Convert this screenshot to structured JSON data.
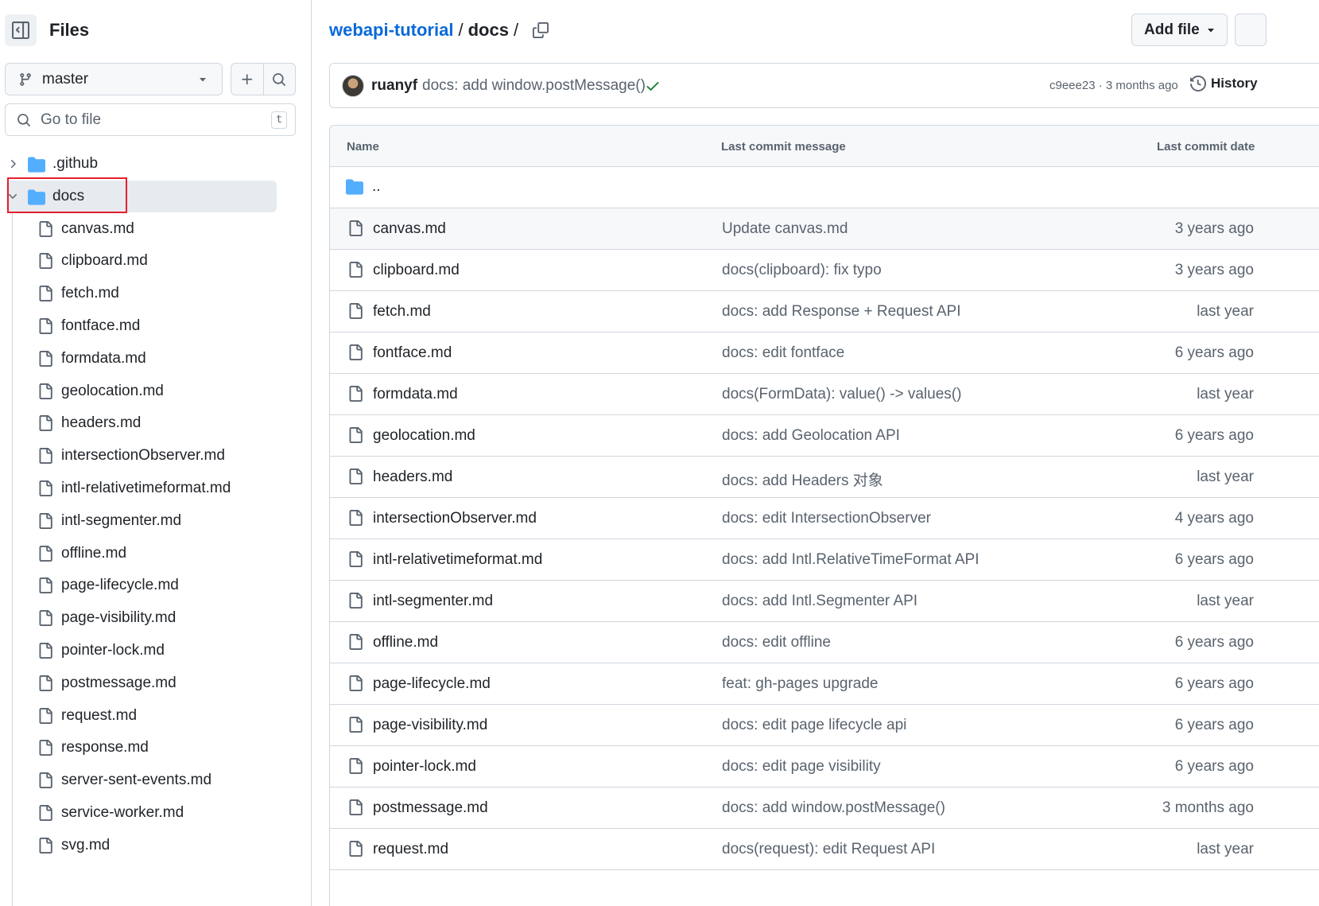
{
  "sidebar": {
    "title": "Files",
    "toggle_icon": "sidebar-collapse-icon",
    "branch": "master",
    "search_placeholder": "Go to file",
    "search_shortcut": "t",
    "tree": [
      {
        "type": "dir",
        "name": ".github",
        "expanded": false
      },
      {
        "type": "dir",
        "name": "docs",
        "expanded": true,
        "selected": true
      },
      {
        "type": "file",
        "name": "canvas.md"
      },
      {
        "type": "file",
        "name": "clipboard.md"
      },
      {
        "type": "file",
        "name": "fetch.md"
      },
      {
        "type": "file",
        "name": "fontface.md"
      },
      {
        "type": "file",
        "name": "formdata.md"
      },
      {
        "type": "file",
        "name": "geolocation.md"
      },
      {
        "type": "file",
        "name": "headers.md"
      },
      {
        "type": "file",
        "name": "intersectionObserver.md"
      },
      {
        "type": "file",
        "name": "intl-relativetimeformat.md"
      },
      {
        "type": "file",
        "name": "intl-segmenter.md"
      },
      {
        "type": "file",
        "name": "offline.md"
      },
      {
        "type": "file",
        "name": "page-lifecycle.md"
      },
      {
        "type": "file",
        "name": "page-visibility.md"
      },
      {
        "type": "file",
        "name": "pointer-lock.md"
      },
      {
        "type": "file",
        "name": "postmessage.md"
      },
      {
        "type": "file",
        "name": "request.md"
      },
      {
        "type": "file",
        "name": "response.md"
      },
      {
        "type": "file",
        "name": "server-sent-events.md"
      },
      {
        "type": "file",
        "name": "service-worker.md"
      },
      {
        "type": "file",
        "name": "svg.md"
      }
    ]
  },
  "breadcrumb": {
    "repo": "webapi-tutorial",
    "sep1": "/",
    "current": "docs",
    "sep2": "/"
  },
  "toolbar": {
    "add_file_label": "Add file"
  },
  "commit": {
    "author": "ruanyf",
    "message": "docs: add window.postMessage()",
    "meta": "c9eee23 · 3 months ago",
    "history_label": "History"
  },
  "table": {
    "headers": [
      "Name",
      "Last commit message",
      "Last commit date"
    ],
    "parent_label": "..",
    "rows": [
      {
        "name": "canvas.md",
        "message": "Update canvas.md",
        "date": "3 years ago"
      },
      {
        "name": "clipboard.md",
        "message": "docs(clipboard): fix typo",
        "date": "3 years ago"
      },
      {
        "name": "fetch.md",
        "message": "docs: add Response + Request API",
        "date": "last year"
      },
      {
        "name": "fontface.md",
        "message": "docs: edit fontface",
        "date": "6 years ago"
      },
      {
        "name": "formdata.md",
        "message": "docs(FormData): value() -> values()",
        "date": "last year"
      },
      {
        "name": "geolocation.md",
        "message": "docs: add Geolocation API",
        "date": "6 years ago"
      },
      {
        "name": "headers.md",
        "message": "docs: add Headers 对象",
        "date": "last year"
      },
      {
        "name": "intersectionObserver.md",
        "message": "docs: edit IntersectionObserver",
        "date": "4 years ago"
      },
      {
        "name": "intl-relativetimeformat.md",
        "message": "docs: add Intl.RelativeTimeFormat API",
        "date": "6 years ago"
      },
      {
        "name": "intl-segmenter.md",
        "message": "docs: add Intl.Segmenter API",
        "date": "last year"
      },
      {
        "name": "offline.md",
        "message": "docs: edit offline",
        "date": "6 years ago"
      },
      {
        "name": "page-lifecycle.md",
        "message": "feat: gh-pages upgrade",
        "date": "6 years ago"
      },
      {
        "name": "page-visibility.md",
        "message": "docs: edit page lifecycle api",
        "date": "6 years ago"
      },
      {
        "name": "pointer-lock.md",
        "message": "docs: edit page visibility",
        "date": "6 years ago"
      },
      {
        "name": "postmessage.md",
        "message": "docs: add window.postMessage()",
        "date": "3 months ago"
      },
      {
        "name": "request.md",
        "message": "docs(request): edit Request API",
        "date": "last year"
      }
    ]
  },
  "colors": {
    "link": "#0969da",
    "folder": "#54aeff",
    "success": "#1a7f37",
    "highlight": "#e5202d"
  }
}
